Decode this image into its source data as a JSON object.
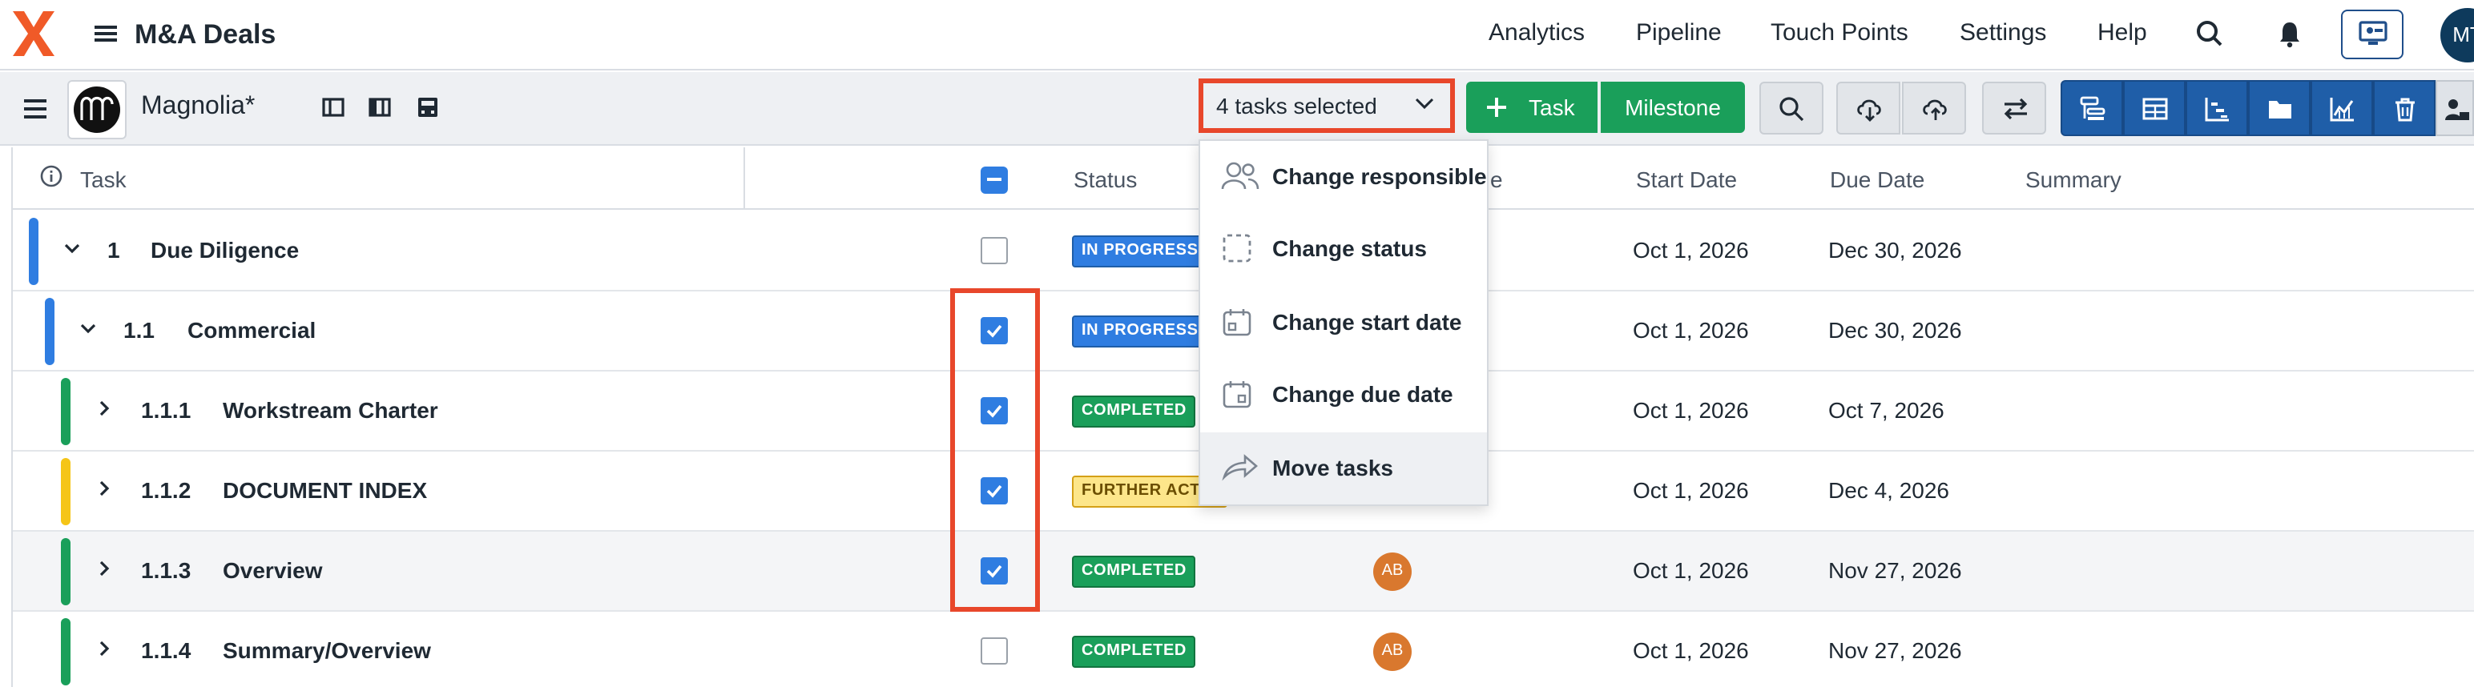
{
  "app": {
    "title": "M&A Deals",
    "avatar_initials": "MT"
  },
  "nav": {
    "items": [
      "Analytics",
      "Pipeline",
      "Touch Points",
      "Settings",
      "Help"
    ]
  },
  "toolbar": {
    "project_name": "Magnolia*",
    "tasks_selected": "4 tasks selected",
    "task_button": "Task",
    "milestone_button": "Milestone"
  },
  "table": {
    "headers": {
      "task": "Task",
      "status": "Status",
      "start": "Start Date",
      "due": "Due Date",
      "summary": "Summary",
      "responsible_partial": "e"
    },
    "rows": [
      {
        "num": "1",
        "name": "Due Diligence",
        "checked": false,
        "status": "IN PROGRESS",
        "status_color": "blue",
        "avatar": "",
        "start": "Oct 1, 2026",
        "due": "Dec 30, 2026",
        "bar_color": "#2f7de1"
      },
      {
        "num": "1.1",
        "name": "Commercial",
        "checked": true,
        "status": "IN PROGRESS",
        "status_color": "blue",
        "avatar": "",
        "start": "Oct 1, 2026",
        "due": "Dec 30, 2026",
        "bar_color": "#2f7de1"
      },
      {
        "num": "1.1.1",
        "name": "Workstream Charter",
        "checked": true,
        "status": "COMPLETED",
        "status_color": "green",
        "avatar": "",
        "start": "Oct 1, 2026",
        "due": "Oct 7, 2026",
        "bar_color": "#1a9f5a"
      },
      {
        "num": "1.1.2",
        "name": "DOCUMENT INDEX",
        "checked": true,
        "status": "FURTHER ACTIO",
        "status_color": "yellow",
        "avatar": "",
        "start": "Oct 1, 2026",
        "due": "Dec 4, 2026",
        "bar_color": "#f5c518"
      },
      {
        "num": "1.1.3",
        "name": "Overview",
        "checked": true,
        "status": "COMPLETED",
        "status_color": "green",
        "avatar": "AB",
        "start": "Oct 1, 2026",
        "due": "Nov 27, 2026",
        "bar_color": "#1a9f5a"
      },
      {
        "num": "1.1.4",
        "name": "Summary/Overview",
        "checked": false,
        "status": "COMPLETED",
        "status_color": "green",
        "avatar": "AB",
        "start": "Oct 1, 2026",
        "due": "Nov 27, 2026",
        "bar_color": "#1a9f5a"
      }
    ]
  },
  "dropdown": {
    "items": [
      "Change responsible",
      "Change status",
      "Change start date",
      "Change due date",
      "Move tasks"
    ],
    "hovered": "Move tasks"
  },
  "colors": {
    "accent_green": "#1a9f5a",
    "accent_blue": "#1f5ea8",
    "highlight_red": "#e8472b",
    "logo_orange": "#f05a28"
  }
}
